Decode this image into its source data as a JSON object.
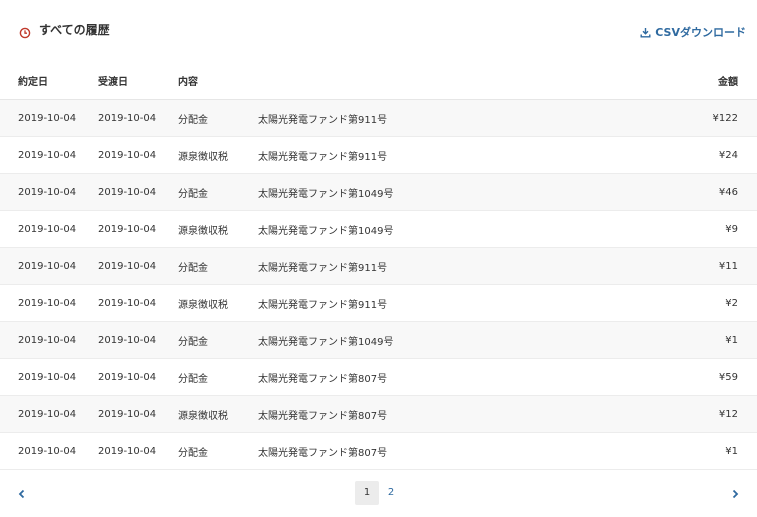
{
  "header": {
    "title": "すべての履歴",
    "csv_label": "CSVダウンロード"
  },
  "colors": {
    "accent": "#2f6aa0",
    "clock": "#c0392b"
  },
  "icons": {
    "title": "clock-icon",
    "csv": "download-icon",
    "prev": "chevron-left-icon",
    "next": "chevron-right-icon"
  },
  "table": {
    "headers": {
      "contract_date": "約定日",
      "delivery_date": "受渡日",
      "content": "内容",
      "fund": "",
      "amount": "金額"
    },
    "rows": [
      {
        "contract_date": "2019-10-04",
        "delivery_date": "2019-10-04",
        "type": "分配金",
        "fund": "太陽光発電ファンド第911号",
        "amount": "¥122"
      },
      {
        "contract_date": "2019-10-04",
        "delivery_date": "2019-10-04",
        "type": "源泉徴収税",
        "fund": "太陽光発電ファンド第911号",
        "amount": "¥24"
      },
      {
        "contract_date": "2019-10-04",
        "delivery_date": "2019-10-04",
        "type": "分配金",
        "fund": "太陽光発電ファンド第1049号",
        "amount": "¥46"
      },
      {
        "contract_date": "2019-10-04",
        "delivery_date": "2019-10-04",
        "type": "源泉徴収税",
        "fund": "太陽光発電ファンド第1049号",
        "amount": "¥9"
      },
      {
        "contract_date": "2019-10-04",
        "delivery_date": "2019-10-04",
        "type": "分配金",
        "fund": "太陽光発電ファンド第911号",
        "amount": "¥11"
      },
      {
        "contract_date": "2019-10-04",
        "delivery_date": "2019-10-04",
        "type": "源泉徴収税",
        "fund": "太陽光発電ファンド第911号",
        "amount": "¥2"
      },
      {
        "contract_date": "2019-10-04",
        "delivery_date": "2019-10-04",
        "type": "分配金",
        "fund": "太陽光発電ファンド第1049号",
        "amount": "¥1"
      },
      {
        "contract_date": "2019-10-04",
        "delivery_date": "2019-10-04",
        "type": "分配金",
        "fund": "太陽光発電ファンド第807号",
        "amount": "¥59"
      },
      {
        "contract_date": "2019-10-04",
        "delivery_date": "2019-10-04",
        "type": "源泉徴収税",
        "fund": "太陽光発電ファンド第807号",
        "amount": "¥12"
      },
      {
        "contract_date": "2019-10-04",
        "delivery_date": "2019-10-04",
        "type": "分配金",
        "fund": "太陽光発電ファンド第807号",
        "amount": "¥1"
      }
    ]
  },
  "pagination": {
    "pages": [
      "1",
      "2"
    ],
    "current": "1"
  }
}
